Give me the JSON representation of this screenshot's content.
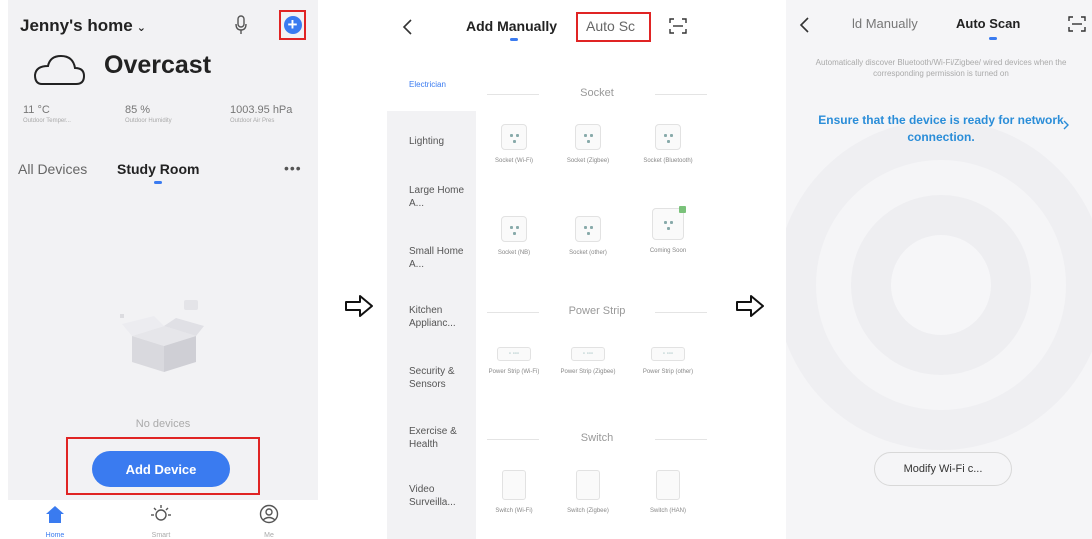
{
  "panel1": {
    "home_name": "Jenny's home",
    "home_chevron": "⌄",
    "weather": {
      "condition": "Overcast",
      "stats": [
        {
          "value": "11 °C",
          "label": "Outdoor Temper..."
        },
        {
          "value": "85 %",
          "label": "Outdoor Humidity"
        },
        {
          "value": "1003.95 hPa",
          "label": "Outdoor Air Pres"
        }
      ]
    },
    "tabs": [
      {
        "label": "All Devices",
        "active": false
      },
      {
        "label": "Study Room",
        "active": true
      }
    ],
    "more": "•••",
    "empty_text": "No devices",
    "add_device_label": "Add Device",
    "nav": [
      {
        "label": "Home",
        "icon": "home-icon",
        "active": true
      },
      {
        "label": "Smart",
        "icon": "sun-icon",
        "active": false
      },
      {
        "label": "Me",
        "icon": "profile-icon",
        "active": false
      }
    ],
    "accent": "#3a7bf0",
    "highlight": "#e02424"
  },
  "panel2": {
    "tab_manual": "Add Manually",
    "tab_auto": "Auto Sc",
    "sidebar": [
      {
        "label": "Electrician",
        "selected": true
      },
      {
        "label": "Lighting",
        "selected": false
      },
      {
        "label": "Large Home A...",
        "selected": false
      },
      {
        "label": "Small Home A...",
        "selected": false
      },
      {
        "label": "Kitchen Applianc...",
        "selected": false
      },
      {
        "label": "Security & Sensors",
        "selected": false
      },
      {
        "label": "Exercise & Health",
        "selected": false
      },
      {
        "label": "Video Surveilla...",
        "selected": false
      }
    ],
    "sections": [
      {
        "title": "Socket",
        "items": [
          {
            "label": "Socket (Wi-Fi)"
          },
          {
            "label": "Socket (Zigbee)"
          },
          {
            "label": "Socket (Bluetooth)"
          },
          {
            "label": "Socket (NB)"
          },
          {
            "label": "Socket (other)"
          },
          {
            "label": "Coming Soon"
          }
        ]
      },
      {
        "title": "Power Strip",
        "items": [
          {
            "label": "Power Strip (Wi-Fi)"
          },
          {
            "label": "Power Strip (Zigbee)"
          },
          {
            "label": "Power Strip (other)"
          }
        ]
      },
      {
        "title": "Switch",
        "items": [
          {
            "label": "Switch (Wi-Fi)"
          },
          {
            "label": "Switch (Zigbee)"
          },
          {
            "label": "Switch (HAN)"
          }
        ]
      }
    ]
  },
  "panel3": {
    "tab_manual": "ld Manually",
    "tab_auto": "Auto Scan",
    "description": "Automatically discover Bluetooth/Wi-Fi/Zigbee/ wired devices when the corresponding permission is turned on",
    "ensure_text": "Ensure that the device is ready for network connection.",
    "modify_label": "Modify Wi-Fi c..."
  }
}
